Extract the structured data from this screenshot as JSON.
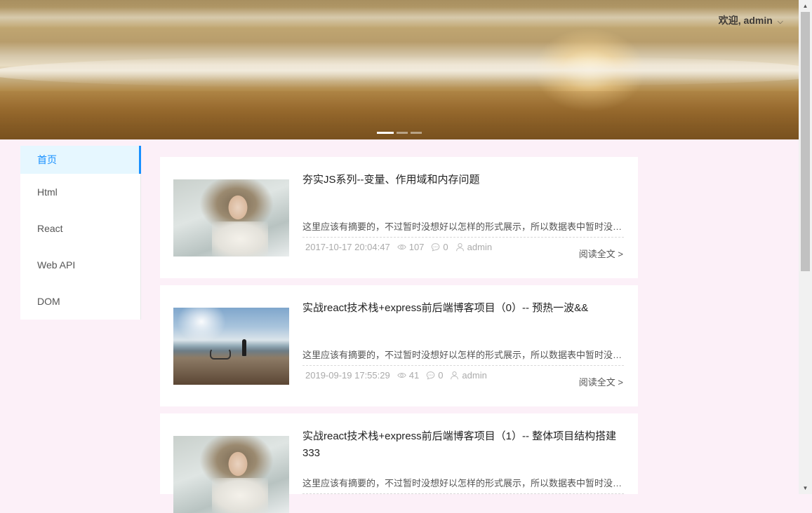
{
  "header": {
    "welcome_prefix": "欢迎,",
    "username": "admin",
    "chevron": "⌵",
    "carousel_total": 3,
    "carousel_active": 1
  },
  "sidebar": {
    "items": [
      {
        "label": "首页",
        "active": true
      },
      {
        "label": "Html",
        "active": false
      },
      {
        "label": "React",
        "active": false
      },
      {
        "label": "Web API",
        "active": false
      },
      {
        "label": "DOM",
        "active": false
      }
    ]
  },
  "articles": [
    {
      "title": "夯实JS系列--变量、作用域和内存问题",
      "summary": "这里应该有摘要的，不过暂时没想好以怎样的形式展示，所以数据表中暂时没有摘要字段",
      "date": "2017-10-17 20:04:47",
      "views": "107",
      "comments": "0",
      "author": "admin",
      "read_more": "阅读全文 >",
      "thumbnail": "girl-photo"
    },
    {
      "title": "实战react技术栈+express前后端博客项目（0）-- 预热一波&&",
      "summary": "这里应该有摘要的，不过暂时没想好以怎样的形式展示，所以数据表中暂时没有摘要字段",
      "date": "2019-09-19 17:55:29",
      "views": "41",
      "comments": "0",
      "author": "admin",
      "read_more": "阅读全文 >",
      "thumbnail": "beach-photo"
    },
    {
      "title": "实战react技术栈+express前后端博客项目（1）-- 整体项目结构搭建333",
      "summary": "这里应该有摘要的，不过暂时没想好以怎样的形式展示，所以数据表中暂时没有摘要字段",
      "thumbnail": "girl-photo"
    }
  ],
  "icons": {
    "views": "eye-icon",
    "comments": "comment-icon",
    "author": "user-icon"
  },
  "colors": {
    "accent": "#1890ff",
    "active_bg": "#e6f7ff",
    "page_bg": "#fcf0f8"
  }
}
